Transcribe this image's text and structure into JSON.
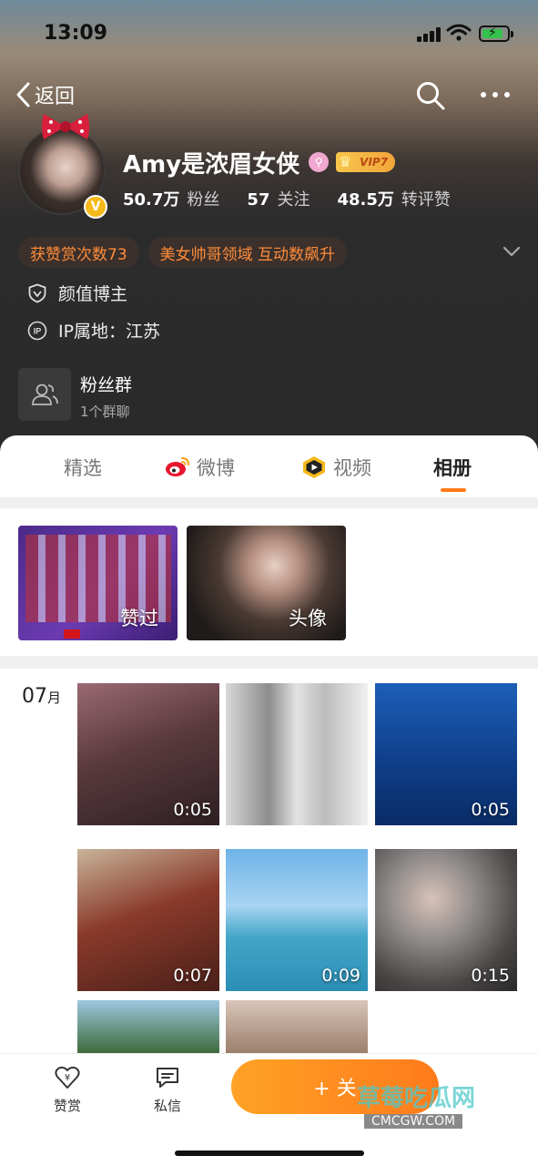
{
  "status_bar": {
    "time": "13:09"
  },
  "nav": {
    "back_label": "返回"
  },
  "profile": {
    "name": "Amy是浓眉女侠",
    "vip_label": "VIP7",
    "verified_badge": "V",
    "stats": [
      {
        "value": "50.7万",
        "label": "粉丝"
      },
      {
        "value": "57",
        "label": "关注"
      },
      {
        "value": "48.5万",
        "label": "转评赞"
      }
    ],
    "tags": [
      "获赞赏次数73",
      "美女帅哥领域 互动数飙升"
    ],
    "category": "颜值博主",
    "ip_location": "IP属地：江苏",
    "fan_group": {
      "title": "粉丝群",
      "subtitle": "1个群聊"
    }
  },
  "tabs": [
    {
      "label": "精选",
      "icon": "none"
    },
    {
      "label": "微博",
      "icon": "weibo-icon"
    },
    {
      "label": "视频",
      "icon": "video-icon"
    },
    {
      "label": "相册",
      "icon": "none",
      "active": true
    }
  ],
  "albums": [
    {
      "caption": "赞过"
    },
    {
      "caption": "头像"
    }
  ],
  "month": {
    "number": "07",
    "unit": "月"
  },
  "videos": [
    {
      "duration": "0:05"
    },
    {
      "duration": ""
    },
    {
      "duration": "0:05"
    },
    {
      "duration": "0:07"
    },
    {
      "duration": "0:09"
    },
    {
      "duration": "0:15"
    },
    {
      "duration": ""
    },
    {
      "duration": ""
    }
  ],
  "bottom_bar": {
    "reward_label": "赞赏",
    "message_label": "私信",
    "follow_label": "+ 关",
    "watermark": "草莓吃瓜网",
    "watermark_sub": "CMCGW.COM"
  },
  "colors": {
    "accent": "#ff7a1a",
    "tag_text": "#ff8c3a",
    "vip_gold": "#f7c64c"
  }
}
